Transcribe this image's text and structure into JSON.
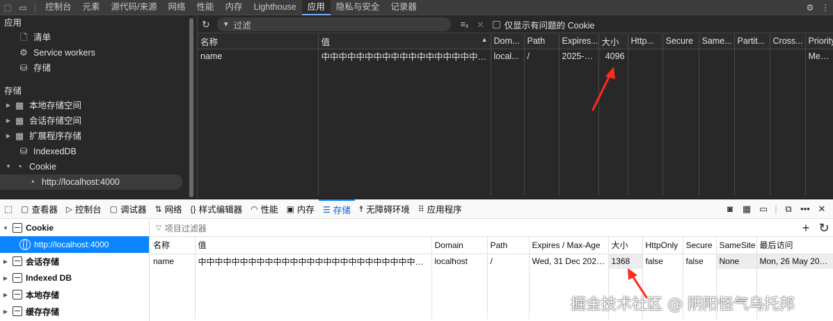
{
  "chrome": {
    "tabs": [
      "控制台",
      "元素",
      "源代码/来源",
      "网络",
      "性能",
      "内存",
      "Lighthouse",
      "应用",
      "隐私与安全",
      "记录器"
    ],
    "active_tab": "应用",
    "sidebar": {
      "app_heading": "应用",
      "app_items": [
        {
          "label": "清单",
          "icon": "document-icon"
        },
        {
          "label": "Service workers",
          "icon": "gears-icon"
        },
        {
          "label": "存储",
          "icon": "database-icon"
        }
      ],
      "storage_heading": "存储",
      "storage_items": [
        {
          "label": "本地存储空间",
          "icon": "table-icon"
        },
        {
          "label": "会话存储空间",
          "icon": "table-icon"
        },
        {
          "label": "扩展程序存储",
          "icon": "table-icon"
        },
        {
          "label": "IndexedDB",
          "icon": "database-icon"
        },
        {
          "label": "Cookie",
          "icon": "cookie-icon"
        }
      ],
      "selected_origin": "http://localhost:4000"
    },
    "toolbar": {
      "filter_placeholder": "过滤",
      "only_issues_label": "仅显示有问题的 Cookie"
    },
    "columns": [
      "名称",
      "值",
      "Dom...",
      "Path",
      "Expires...",
      "大小",
      "Http...",
      "Secure",
      "Same...",
      "Partit...",
      "Cross...",
      "Priority"
    ],
    "row": {
      "name": "name",
      "value": "中中中中中中中中中中中中中中中中中中中中中中中中中中中中",
      "domain": "local...",
      "path": "/",
      "expires": "2025-1...",
      "size": "4096",
      "priority": "Medi..."
    }
  },
  "firefox": {
    "tabs": [
      {
        "label": "查看器",
        "icon": "inspector-icon"
      },
      {
        "label": "控制台",
        "icon": "console-icon"
      },
      {
        "label": "调试器",
        "icon": "debugger-icon"
      },
      {
        "label": "网络",
        "icon": "network-icon"
      },
      {
        "label": "样式编辑器",
        "icon": "style-editor-icon"
      },
      {
        "label": "性能",
        "icon": "performance-icon"
      },
      {
        "label": "内存",
        "icon": "memory-icon"
      },
      {
        "label": "存储",
        "icon": "storage-icon"
      },
      {
        "label": "无障碍环境",
        "icon": "accessibility-icon"
      },
      {
        "label": "应用程序",
        "icon": "application-icon"
      }
    ],
    "active_tab": "存储",
    "sidebar": [
      {
        "label": "Cookie",
        "bold": true
      },
      {
        "label": "http://localhost:4000",
        "selected": true
      },
      {
        "label": "会话存储",
        "bold": true
      },
      {
        "label": "Indexed DB",
        "bold": true
      },
      {
        "label": "本地存储",
        "bold": true
      },
      {
        "label": "缓存存储",
        "bold": true
      }
    ],
    "filter_placeholder": "项目过滤器",
    "columns": [
      "名称",
      "值",
      "Domain",
      "Path",
      "Expires / Max-Age",
      "大小",
      "HttpOnly",
      "Secure",
      "SameSite",
      "最后访问"
    ],
    "row": {
      "name": "name",
      "value": "中中中中中中中中中中中中中中中中中中中中中中中中中中中中中中中中中中中中",
      "domain": "localhost",
      "path": "/",
      "expires": "Wed, 31 Dec 2025...",
      "size": "1368",
      "httponly": "false",
      "secure": "false",
      "samesite": "None",
      "last_accessed": "Mon, 26 May 202..."
    }
  },
  "watermark": "掘金技术社区 @ 阴阳怪气乌托邦",
  "colors": {
    "annotation_arrow": "#ff2a1a",
    "chrome_accent": "#7cacf8",
    "firefox_accent": "#0a84ff"
  }
}
